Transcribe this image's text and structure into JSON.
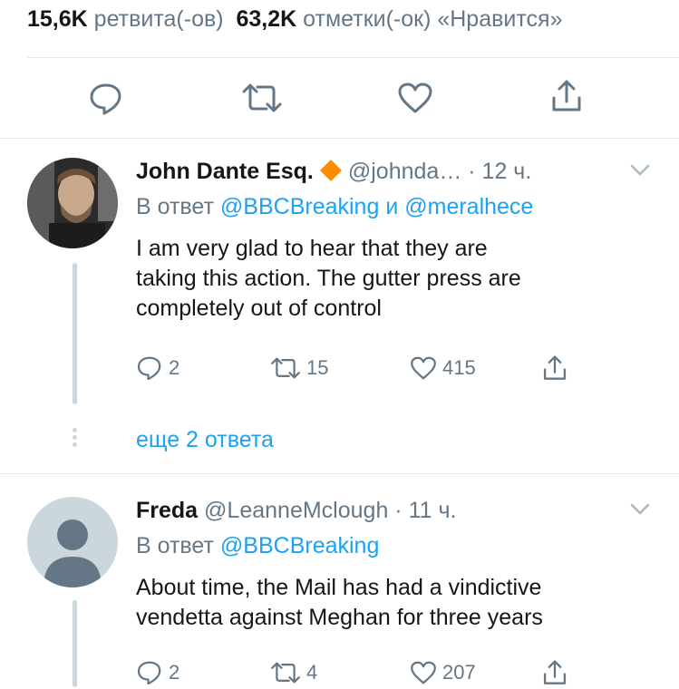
{
  "stats": {
    "retweets_count": "15,6K",
    "retweets_label": "ретвита(-ов)",
    "likes_count": "63,2K",
    "likes_label": "отметки(-ок) «Нравится»"
  },
  "tweets": [
    {
      "name": "John Dante Esq.",
      "handle": "@johnda…",
      "time": "· 12 ч.",
      "reply_prefix": "В ответ",
      "mention1": "@BBCBreaking",
      "conj": "и",
      "mention2": "@meralhece",
      "text_lines": [
        "I am very glad to hear that they are",
        "taking this action.  The gutter press are",
        "completely out of control"
      ],
      "replies": "2",
      "retweets": "15",
      "likes": "415",
      "more_replies": "еще 2 ответа"
    },
    {
      "name": "Freda",
      "handle": "@LeanneMclough",
      "time": "· 11 ч.",
      "reply_prefix": "В ответ",
      "mention1": "@BBCBreaking",
      "text_lines": [
        "About time, the Mail has had a vindictive",
        "vendetta against Meghan for three years"
      ],
      "replies": "2",
      "retweets": "4",
      "likes": "207"
    }
  ],
  "colors": {
    "accent": "#1da1f2",
    "secondary_text": "#657786",
    "divider": "#e1e8ed",
    "verified_badge": "#ff8c00"
  }
}
